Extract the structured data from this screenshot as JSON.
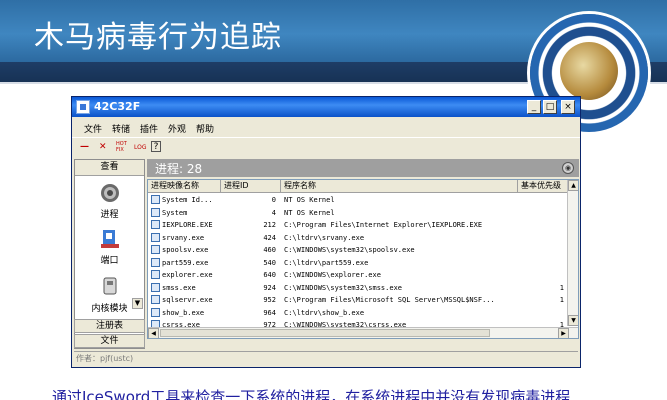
{
  "slide": {
    "title": "木马病毒行为追踪",
    "caption": "通过IceSword工具来检查一下系统的进程，在系统进程中并没有发现病毒进程"
  },
  "window": {
    "title": "42C32F",
    "controls": [
      "_",
      "□",
      "×"
    ]
  },
  "menu": [
    "文件",
    "转储",
    "插件",
    "外观",
    "帮助"
  ],
  "toolbar": {
    "icons": [
      "minus-icon",
      "delete-icon",
      "hook-icon",
      "log-icon",
      "help-icon"
    ],
    "labels": [
      "—",
      "✕",
      "HOT FIX",
      "LOG",
      "?"
    ]
  },
  "sidebar": {
    "header": "查看",
    "items": [
      {
        "label": "进程",
        "icon": "process-gear-icon"
      },
      {
        "label": "端口",
        "icon": "port-icon"
      },
      {
        "label": "内核模块",
        "icon": "kernel-module-icon"
      }
    ],
    "footer_items": [
      "注册表",
      "文件"
    ]
  },
  "content": {
    "header": "进程: 28",
    "columns": [
      "进程映像名称",
      "进程ID",
      "程序名称",
      "基本优先级"
    ],
    "rows": [
      {
        "name": "System Id...",
        "pid": "0",
        "path": "NT OS Kernel",
        "prio": ""
      },
      {
        "name": "System",
        "pid": "4",
        "path": "NT OS Kernel",
        "prio": ""
      },
      {
        "name": "IEXPLORE.EXE",
        "pid": "212",
        "path": "C:\\Program Files\\Internet Explorer\\IEXPLORE.EXE",
        "prio": ""
      },
      {
        "name": "srvany.exe",
        "pid": "424",
        "path": "C:\\ltdrv\\srvany.exe",
        "prio": ""
      },
      {
        "name": "spoolsv.exe",
        "pid": "460",
        "path": "C:\\WINDOWS\\system32\\spoolsv.exe",
        "prio": ""
      },
      {
        "name": "part559.exe",
        "pid": "540",
        "path": "C:\\ltdrv\\part559.exe",
        "prio": ""
      },
      {
        "name": "explorer.exe",
        "pid": "640",
        "path": "C:\\WINDOWS\\explorer.exe",
        "prio": ""
      },
      {
        "name": "smss.exe",
        "pid": "924",
        "path": "C:\\WINDOWS\\system32\\smss.exe",
        "prio": "1"
      },
      {
        "name": "sqlservr.exe",
        "pid": "952",
        "path": "C:\\Program Files\\Microsoft SQL Server\\MSSQL$NSF...",
        "prio": "1"
      },
      {
        "name": "show_b.exe",
        "pid": "964",
        "path": "C:\\ltdrv\\show_b.exe",
        "prio": ""
      },
      {
        "name": "csrss.exe",
        "pid": "972",
        "path": "C:\\WINDOWS\\system32\\csrss.exe",
        "prio": "1"
      }
    ]
  },
  "statusbar": "作者：pjf(ustc)"
}
